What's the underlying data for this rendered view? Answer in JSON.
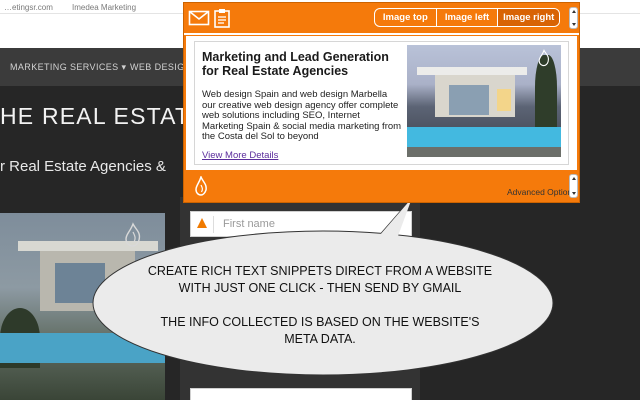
{
  "browser": {
    "bookmarks": [
      "…etingsr.com",
      "Imedea Marketing"
    ]
  },
  "website": {
    "nav": {
      "items": [
        "MARKETING SERVICES ▾",
        "WEB DESIGN"
      ]
    },
    "hero": {
      "title": "HE REAL ESTATE SE",
      "subtitle": "r Real Estate Agencies &"
    },
    "form": {
      "first_name_placeholder": "First name"
    }
  },
  "popup": {
    "tabs": [
      {
        "label": "Image top",
        "active": false
      },
      {
        "label": "Image left",
        "active": false
      },
      {
        "label": "Image right",
        "active": true
      }
    ],
    "card": {
      "title": "Marketing and Lead Generation for Real Estate Agencies",
      "description": "Web design Spain and web design Marbella our creative web design agency offer complete web solutions including SEO, Internet Marketing Spain & social media marketing from the Costa del Sol to beyond",
      "link_text": "View More Details"
    },
    "footer": {
      "advanced_options": "Advanced Options"
    },
    "icons": {
      "mail": "mail-icon",
      "clipboard": "clipboard-icon",
      "brand": "flame-logo-icon"
    }
  },
  "bubble": {
    "line1": "CREATE RICH TEXT SNIPPETS DIRECT FROM A WEBSITE",
    "line2": "WITH JUST ONE CLICK - THEN SEND BY GMAIL",
    "line3": "THE INFO COLLECTED IS BASED ON THE WEBSITE'S",
    "line4": "META DATA."
  },
  "colors": {
    "accent": "#f57a0b",
    "active_tab": "#d86304",
    "link": "#5b2d9c",
    "site_dark": "#262626"
  }
}
